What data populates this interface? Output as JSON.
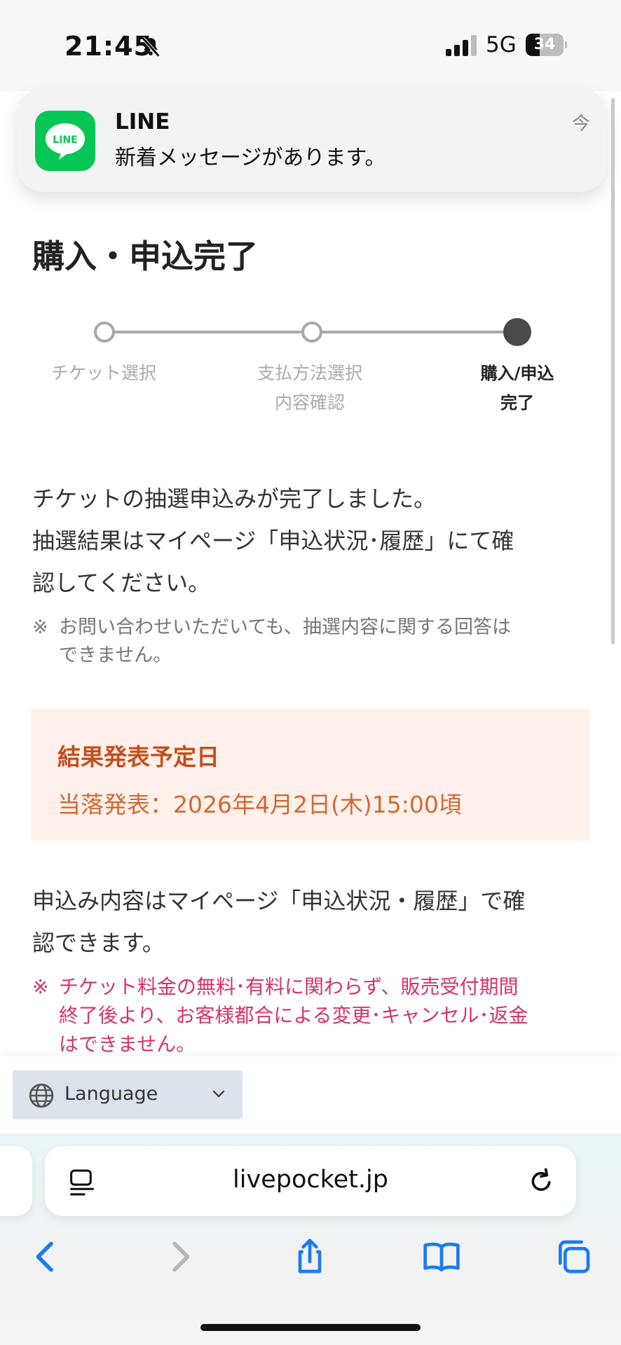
{
  "status_bar": {
    "time": "21:45",
    "network": "5G",
    "battery": "34"
  },
  "notification": {
    "app": "LINE",
    "logo_text": "LINE",
    "message": "新着メッセージがあります。",
    "time": "今"
  },
  "page": {
    "title": "購入・申込完了",
    "steps": [
      {
        "line1": "チケット選択",
        "line2": "",
        "active": false
      },
      {
        "line1": "支払方法選択",
        "line2": "内容確認",
        "active": false
      },
      {
        "line1": "購入/申込",
        "line2": "完了",
        "active": true
      }
    ],
    "message_lines": [
      "チケットの抽選申込みが完了しました。",
      "抽選結果はマイページ「申込状況･履歴」にて確",
      "認してください。"
    ],
    "note": {
      "mark": "※",
      "lines": [
        "お問い合わせいただいても、抽選内容に関する回答は",
        "できません。"
      ]
    },
    "result_box": {
      "title": "結果発表予定日",
      "date": "当落発表：2026年4月2日(木)15:00頃",
      "title_color": "#c2501b",
      "bg_color": "#fff0eb"
    },
    "history_lines": [
      "申込み内容はマイページ「申込状況・履歴」で確",
      "認できます。"
    ],
    "warning": {
      "mark": "※",
      "lines": [
        "チケット料金の無料･有料に関わらず、販売受付期間",
        "終了後より、お客様都合による変更･キャンセル･返金",
        "はできません。"
      ],
      "color": "#d6336c"
    }
  },
  "language": {
    "label": "Language"
  },
  "browser": {
    "url": "livepocket.jp"
  },
  "colors": {
    "line_green": "#06c755",
    "accent_blue": "#1a7cf0",
    "step_active": "#4a4a4a",
    "step_inactive": "#a8a8a8"
  }
}
